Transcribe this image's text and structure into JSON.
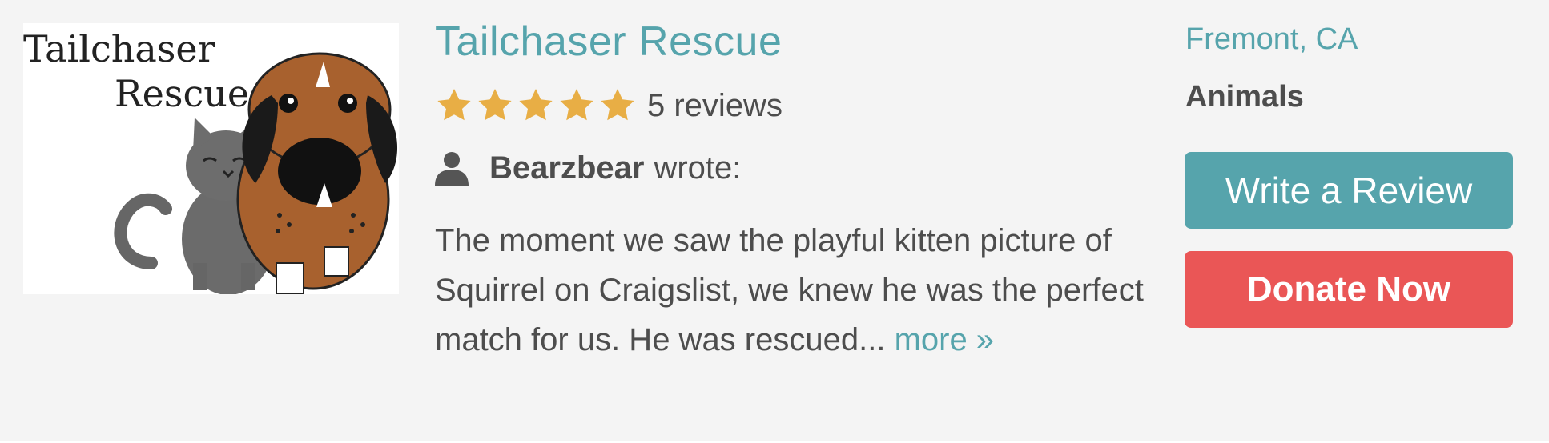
{
  "org": {
    "name": "Tailchaser Rescue",
    "logo": {
      "line1": "Tailchaser",
      "line2": "Rescue",
      "alt_icon": "cat-and-dog-logo"
    },
    "location": "Fremont, CA",
    "category": "Animals"
  },
  "rating": {
    "stars": 5,
    "max_stars": 5,
    "reviews_label": "5 reviews",
    "star_color": "#e8ae45"
  },
  "review": {
    "author": "Bearzbear",
    "wrote_label": "wrote:",
    "excerpt": "The moment we saw the playful kitten picture of Squirrel on Craigslist, we knew he was the perfect match for us. He was rescued... ",
    "more_label": "more »"
  },
  "actions": {
    "write_review_label": "Write a Review",
    "donate_label": "Donate Now"
  },
  "colors": {
    "accent": "#56a4ac",
    "donate": "#ea5656",
    "text": "#4d4d4d",
    "background": "#f4f4f4"
  }
}
